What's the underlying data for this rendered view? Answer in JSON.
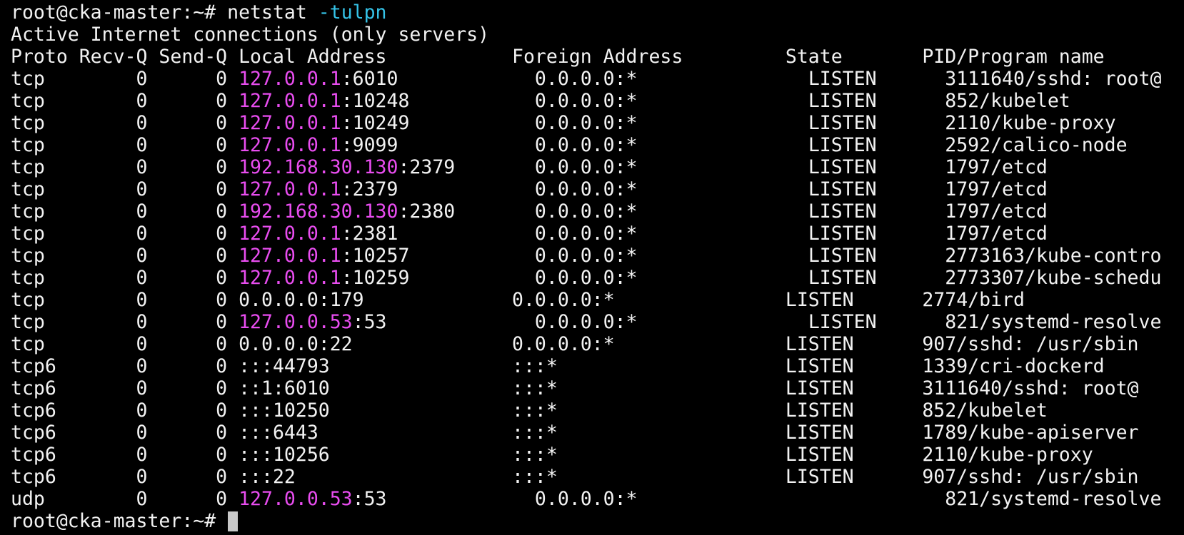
{
  "terminal": {
    "prompt": "root@cka-master:~# ",
    "command": "netstat ",
    "command_flag": "-tulpn",
    "header1": "Active Internet connections (only servers)",
    "header2": "Proto Recv-Q Send-Q Local Address           Foreign Address         State       PID/Program name",
    "rows": [
      {
        "pre": "tcp        0      0 ",
        "ip": "127.0.0.1",
        "post": ":6010            0.0.0.0:*               LISTEN      3111640/sshd: root@"
      },
      {
        "pre": "tcp        0      0 ",
        "ip": "127.0.0.1",
        "post": ":10248           0.0.0.0:*               LISTEN      852/kubelet"
      },
      {
        "pre": "tcp        0      0 ",
        "ip": "127.0.0.1",
        "post": ":10249           0.0.0.0:*               LISTEN      2110/kube-proxy"
      },
      {
        "pre": "tcp        0      0 ",
        "ip": "127.0.0.1",
        "post": ":9099            0.0.0.0:*               LISTEN      2592/calico-node"
      },
      {
        "pre": "tcp        0      0 ",
        "ip": "192.168.30.130",
        "post": ":2379       0.0.0.0:*               LISTEN      1797/etcd"
      },
      {
        "pre": "tcp        0      0 ",
        "ip": "127.0.0.1",
        "post": ":2379            0.0.0.0:*               LISTEN      1797/etcd"
      },
      {
        "pre": "tcp        0      0 ",
        "ip": "192.168.30.130",
        "post": ":2380       0.0.0.0:*               LISTEN      1797/etcd"
      },
      {
        "pre": "tcp        0      0 ",
        "ip": "127.0.0.1",
        "post": ":2381            0.0.0.0:*               LISTEN      1797/etcd"
      },
      {
        "pre": "tcp        0      0 ",
        "ip": "127.0.0.1",
        "post": ":10257           0.0.0.0:*               LISTEN      2773163/kube-contro"
      },
      {
        "pre": "tcp        0      0 ",
        "ip": "127.0.0.1",
        "post": ":10259           0.0.0.0:*               LISTEN      2773307/kube-schedu"
      },
      {
        "pre": "tcp        0      0 ",
        "ip": "",
        "post": "0.0.0.0:179             0.0.0.0:*               LISTEN      2774/bird"
      },
      {
        "pre": "tcp        0      0 ",
        "ip": "127.0.0.53",
        "post": ":53             0.0.0.0:*               LISTEN      821/systemd-resolve"
      },
      {
        "pre": "tcp        0      0 ",
        "ip": "",
        "post": "0.0.0.0:22              0.0.0.0:*               LISTEN      907/sshd: /usr/sbin"
      },
      {
        "pre": "tcp6       0      0 ",
        "ip": "",
        "post": ":::44793                :::*                    LISTEN      1339/cri-dockerd"
      },
      {
        "pre": "tcp6       0      0 ",
        "ip": "",
        "post": "::1:6010                :::*                    LISTEN      3111640/sshd: root@"
      },
      {
        "pre": "tcp6       0      0 ",
        "ip": "",
        "post": ":::10250                :::*                    LISTEN      852/kubelet"
      },
      {
        "pre": "tcp6       0      0 ",
        "ip": "",
        "post": ":::6443                 :::*                    LISTEN      1789/kube-apiserver"
      },
      {
        "pre": "tcp6       0      0 ",
        "ip": "",
        "post": ":::10256                :::*                    LISTEN      2110/kube-proxy"
      },
      {
        "pre": "tcp6       0      0 ",
        "ip": "",
        "post": ":::22                   :::*                    LISTEN      907/sshd: /usr/sbin"
      },
      {
        "pre": "udp        0      0 ",
        "ip": "127.0.0.53",
        "post": ":53             0.0.0.0:*                           821/systemd-resolve"
      }
    ],
    "final_prompt": "root@cka-master:~# "
  },
  "colors": {
    "background": "#000000",
    "foreground": "#f2f2f2",
    "flag": "#35c3e8",
    "ip_highlight": "#e94df0",
    "cursor": "#c8c8c8"
  }
}
